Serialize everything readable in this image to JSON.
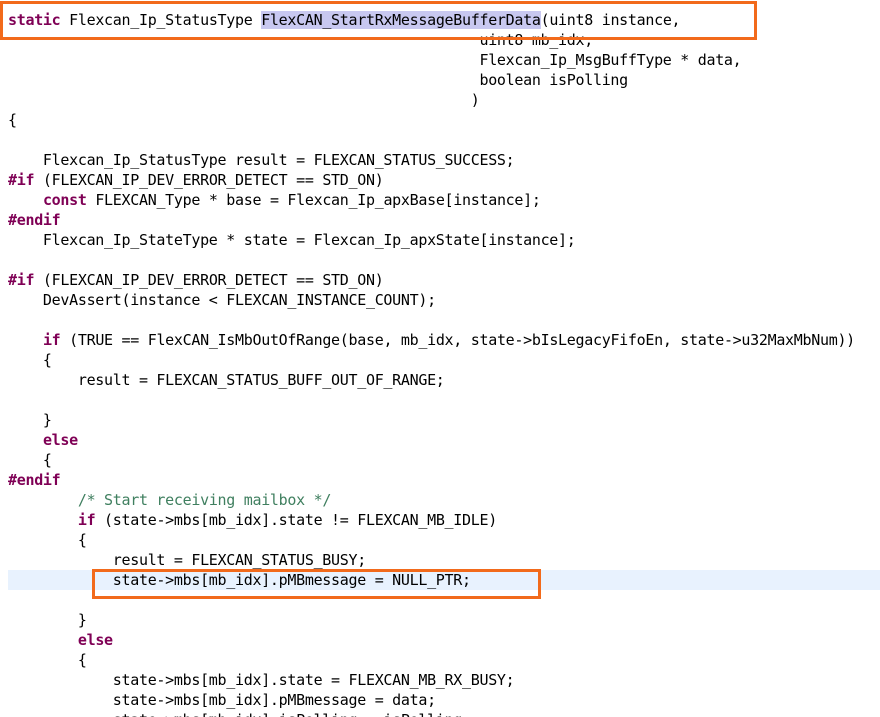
{
  "lines": [
    {
      "text": ""
    },
    {
      "kw": "static",
      "pre": " Flexcan_Ip_StatusType ",
      "sel": "FlexCAN_StartRxMessageBufferData",
      "post": "(uint8 instance,"
    },
    {
      "text": "                                                      uint8 mb_idx,"
    },
    {
      "text": "                                                      Flexcan_Ip_MsgBuffType * data,"
    },
    {
      "text": "                                                      boolean isPolling"
    },
    {
      "text": "                                                     )"
    },
    {
      "text": "{"
    },
    {
      "text": ""
    },
    {
      "text": "    Flexcan_Ip_StatusType result = FLEXCAN_STATUS_SUCCESS;"
    },
    {
      "kw": "#if",
      "post": " (FLEXCAN_IP_DEV_ERROR_DETECT == STD_ON)"
    },
    {
      "indent": "    ",
      "kw": "const",
      "post": " FLEXCAN_Type * base = Flexcan_Ip_apxBase[instance];"
    },
    {
      "kw": "#endif"
    },
    {
      "text": "    Flexcan_Ip_StateType * state = Flexcan_Ip_apxState[instance];"
    },
    {
      "text": ""
    },
    {
      "kw": "#if",
      "post": " (FLEXCAN_IP_DEV_ERROR_DETECT == STD_ON)"
    },
    {
      "text": "    DevAssert(instance < FLEXCAN_INSTANCE_COUNT);"
    },
    {
      "text": ""
    },
    {
      "indent": "    ",
      "kw": "if",
      "post": " (TRUE == FlexCAN_IsMbOutOfRange(base, mb_idx, state->bIsLegacyFifoEn, state->u32MaxMbNum))"
    },
    {
      "text": "    {"
    },
    {
      "text": "        result = FLEXCAN_STATUS_BUFF_OUT_OF_RANGE;"
    },
    {
      "text": ""
    },
    {
      "text": "    }"
    },
    {
      "indent": "    ",
      "kw": "else"
    },
    {
      "text": "    {"
    },
    {
      "kw": "#endif"
    },
    {
      "indent": "        ",
      "cm": "/* Start receiving mailbox */"
    },
    {
      "indent": "        ",
      "kw": "if",
      "post": " (state->mbs[mb_idx].state != FLEXCAN_MB_IDLE)"
    },
    {
      "text": "        {"
    },
    {
      "text": "            result = FLEXCAN_STATUS_BUSY;"
    },
    {
      "text": "            state->mbs[mb_idx].pMBmessage = NULL_PTR;"
    },
    {
      "text": ""
    },
    {
      "text": "        }"
    },
    {
      "indent": "        ",
      "kw": "else"
    },
    {
      "text": "        {"
    },
    {
      "text": "            state->mbs[mb_idx].state = FLEXCAN_MB_RX_BUSY;"
    },
    {
      "text": "            state->mbs[mb_idx].pMBmessage = data;"
    },
    {
      "text": "            state->mbs[mb_idx].isPolling = isPolling;"
    }
  ]
}
